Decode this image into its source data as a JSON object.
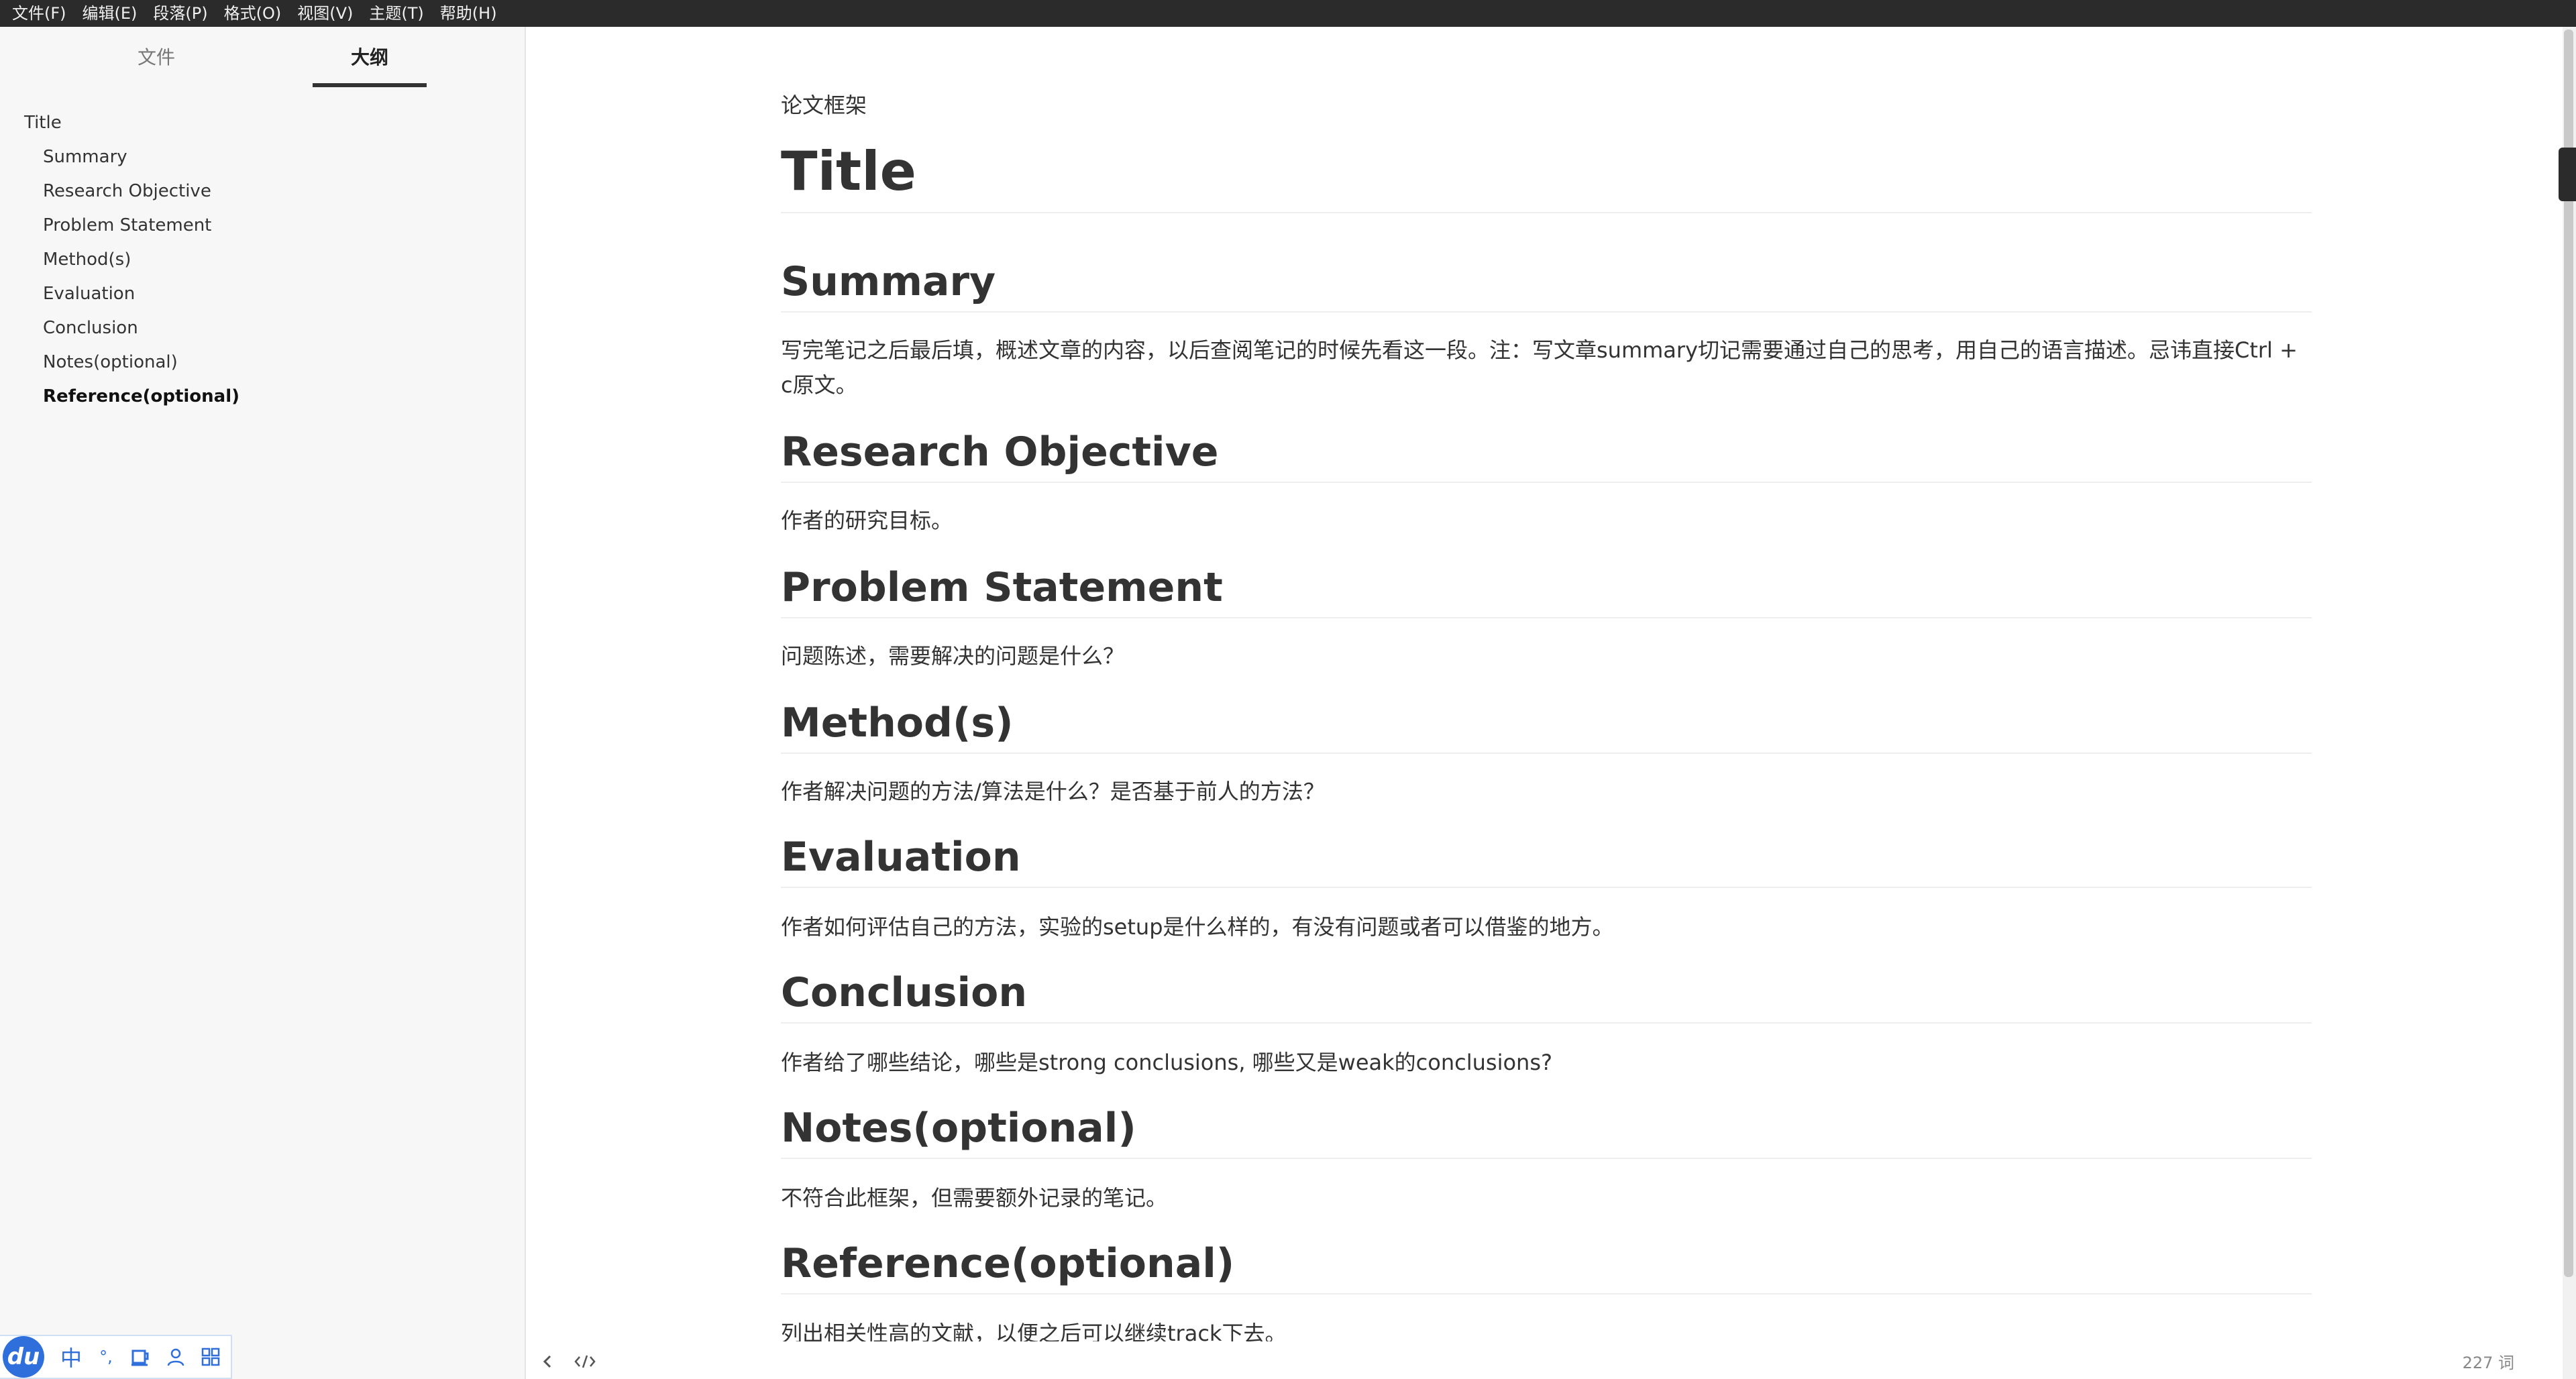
{
  "menu": [
    "文件(F)",
    "编辑(E)",
    "段落(P)",
    "格式(O)",
    "视图(V)",
    "主题(T)",
    "帮助(H)"
  ],
  "sidebar": {
    "tab_files": "文件",
    "tab_outline": "大纲",
    "outline": [
      {
        "label": "Title",
        "level": 1
      },
      {
        "label": "Summary",
        "level": 2
      },
      {
        "label": "Research Objective",
        "level": 2
      },
      {
        "label": "Problem Statement",
        "level": 2
      },
      {
        "label": "Method(s)",
        "level": 2
      },
      {
        "label": "Evaluation",
        "level": 2
      },
      {
        "label": "Conclusion",
        "level": 2
      },
      {
        "label": "Notes(optional)",
        "level": 2
      },
      {
        "label": "Reference(optional)",
        "level": 2,
        "active": true
      }
    ]
  },
  "ime": {
    "logo": "du",
    "mode": "中",
    "punct": "°,"
  },
  "document": {
    "pretitle": "论文框架",
    "title": "Title",
    "sections": [
      {
        "heading": "Summary",
        "body": "写完笔记之后最后填，概述文章的内容，以后查阅笔记的时候先看这一段。注：写文章summary切记需要通过自己的思考，用自己的语言描述。忌讳直接Ctrl + c原文。"
      },
      {
        "heading": "Research Objective",
        "body": "作者的研究目标。"
      },
      {
        "heading": "Problem Statement",
        "body": "问题陈述，需要解决的问题是什么？"
      },
      {
        "heading": "Method(s)",
        "body": "作者解决问题的方法/算法是什么？是否基于前人的方法？"
      },
      {
        "heading": "Evaluation",
        "body": "作者如何评估自己的方法，实验的setup是什么样的，有没有问题或者可以借鉴的地方。"
      },
      {
        "heading": "Conclusion",
        "body": "作者给了哪些结论，哪些是strong conclusions, 哪些又是weak的conclusions?"
      },
      {
        "heading": "Notes(optional)",
        "body": "不符合此框架，但需要额外记录的笔记。"
      },
      {
        "heading": "Reference(optional)",
        "body": "列出相关性高的文献，以便之后可以继续track下去。"
      }
    ]
  },
  "statusbar": {
    "word_count": "227 词",
    "toggle_sidebar_icon": "chevron-left-icon",
    "source_mode_icon": "code-icon"
  }
}
